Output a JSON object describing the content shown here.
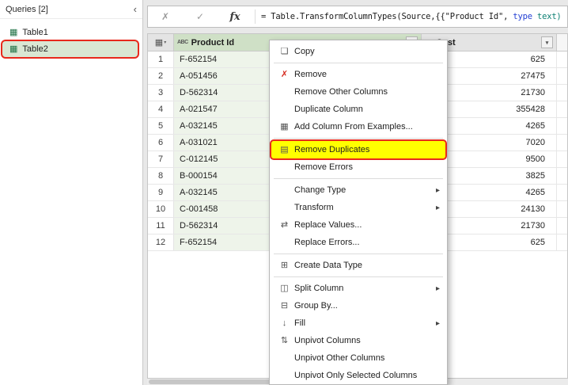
{
  "queries_panel": {
    "title": "Queries [2]",
    "collapse_icon": "‹",
    "items": [
      {
        "label": "Table1",
        "selected": false,
        "annotated": false
      },
      {
        "label": "Table2",
        "selected": true,
        "annotated": true
      }
    ]
  },
  "formula_bar": {
    "cancel_icon": "✗",
    "commit_icon": "✓",
    "fx_label": "fx",
    "formula": [
      {
        "text": "= Table.TransformColumnTypes(Source,{{\"Product Id\", ",
        "color": "#1b1b1b"
      },
      {
        "text": "type",
        "color": "#2440d4"
      },
      {
        "text": " text)",
        "color": "#0e8074"
      }
    ]
  },
  "grid": {
    "corner_icon": "▦",
    "corner_arrow": "▾",
    "filter_arrow": "▾",
    "columns": [
      {
        "type_icon": "ABC",
        "name": "Product Id",
        "selected": true
      },
      {
        "type_icon": "123",
        "name": "Cost",
        "selected": false
      }
    ],
    "rows": [
      {
        "n": "1",
        "id": "F-652154",
        "cost": "625"
      },
      {
        "n": "2",
        "id": "A-051456",
        "cost": "27475"
      },
      {
        "n": "3",
        "id": "D-562314",
        "cost": "21730"
      },
      {
        "n": "4",
        "id": "A-021547",
        "cost": "355428"
      },
      {
        "n": "5",
        "id": "A-032145",
        "cost": "4265"
      },
      {
        "n": "6",
        "id": "A-031021",
        "cost": "7020"
      },
      {
        "n": "7",
        "id": "C-012145",
        "cost": "9500"
      },
      {
        "n": "8",
        "id": "B-000154",
        "cost": "3825"
      },
      {
        "n": "9",
        "id": "A-032145",
        "cost": "4265"
      },
      {
        "n": "10",
        "id": "C-001458",
        "cost": "24130"
      },
      {
        "n": "11",
        "id": "D-562314",
        "cost": "21730"
      },
      {
        "n": "12",
        "id": "F-652154",
        "cost": "625"
      }
    ]
  },
  "context_menu": {
    "submenu_arrow": "▸",
    "items": [
      {
        "label": "Copy",
        "icon": "copy-icon",
        "glyph": "❏",
        "separator_after": true
      },
      {
        "label": "Remove",
        "icon": "remove-icon",
        "glyph": "✗",
        "glyph_color": "#d62b1f"
      },
      {
        "label": "Remove Other Columns"
      },
      {
        "label": "Duplicate Column"
      },
      {
        "label": "Add Column From Examples...",
        "icon": "add-column-from-examples-icon",
        "glyph": "▦",
        "separator_after": true
      },
      {
        "label": "Remove Duplicates",
        "icon": "remove-duplicates-icon",
        "glyph": "▤",
        "highlighted": true
      },
      {
        "label": "Remove Errors",
        "separator_after": true
      },
      {
        "label": "Change Type",
        "submenu": true
      },
      {
        "label": "Transform",
        "submenu": true
      },
      {
        "label": "Replace Values...",
        "icon": "replace-values-icon",
        "glyph": "⇄"
      },
      {
        "label": "Replace Errors...",
        "separator_after": true
      },
      {
        "label": "Create Data Type",
        "icon": "create-data-type-icon",
        "glyph": "⊞",
        "separator_after": true
      },
      {
        "label": "Split Column",
        "icon": "split-column-icon",
        "glyph": "◫",
        "submenu": true
      },
      {
        "label": "Group By...",
        "icon": "group-by-icon",
        "glyph": "⊟"
      },
      {
        "label": "Fill",
        "icon": "fill-icon",
        "glyph": "↓",
        "submenu": true
      },
      {
        "label": "Unpivot Columns",
        "icon": "unpivot-columns-icon",
        "glyph": "⇅"
      },
      {
        "label": "Unpivot Other Columns"
      },
      {
        "label": "Unpivot Only Selected Columns"
      }
    ]
  }
}
